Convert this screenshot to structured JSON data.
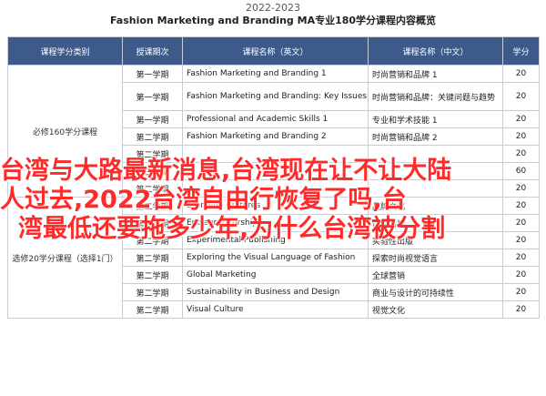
{
  "header": {
    "year": "2022-2023",
    "title": "Fashion Marketing and Branding MA专业180学分课程内容概览"
  },
  "table": {
    "columns": [
      "课程学分类别",
      "授课期次",
      "课程名称（英文）",
      "课程名称（中文）",
      "学分"
    ],
    "categories": [
      "必修160学分课程",
      "选修20学分课程（选择1门）"
    ],
    "rows": [
      {
        "term": "第一学期",
        "en": "Fashion Marketing and Branding 1",
        "cn": "时尚营销和品牌 1",
        "credits": "20"
      },
      {
        "term": "第一学期",
        "en": "Fashion Marketing and Branding: Key Issues and Trends",
        "cn": "时尚营销和品牌：关键问题与趋势",
        "credits": "20"
      },
      {
        "term": "第一学期",
        "en": "Professional and Academic Skills 1",
        "cn": "专业和学术技能 1",
        "credits": "20"
      },
      {
        "term": "第二学期",
        "en": "Fashion Marketing and Branding 2",
        "cn": "时尚营销和品牌 2",
        "credits": "20"
      },
      {
        "term": "第二学期",
        "en": "",
        "cn": "",
        "credits": "20"
      },
      {
        "term": "第三学期",
        "en": "",
        "cn": "",
        "credits": "60"
      },
      {
        "term": "第二学期",
        "en": "",
        "cn": "",
        "credits": "20"
      },
      {
        "term": "第二学期",
        "en": "Branding Cultures",
        "cn": "品牌文化",
        "credits": "20"
      },
      {
        "term": "第二学期",
        "en": "Entrepreneurship",
        "cn": "创业精神",
        "credits": "20"
      },
      {
        "term": "第二学期",
        "en": "Experimental Publishing",
        "cn": "实验性出版",
        "credits": "20"
      },
      {
        "term": "第二学期",
        "en": "Exploring the Visual Language of Fashion",
        "cn": "探索时尚视觉语言",
        "credits": "20"
      },
      {
        "term": "第二学期",
        "en": "Global Marketing",
        "cn": "全球营销",
        "credits": "20"
      },
      {
        "term": "第二学期",
        "en": "Sustainability in Business and Design",
        "cn": "商业与设计的可持续性",
        "credits": "20"
      },
      {
        "term": "第二学期",
        "en": "Visual Culture",
        "cn": "视觉文化",
        "credits": "20"
      }
    ]
  },
  "overlay": {
    "line1": "台湾与大路最新消息,台湾现在让不让大陆",
    "line2": "人过去,2022台湾自由行恢复了吗,台",
    "line3": "湾最低还要拖多少年,为什么台湾被分割"
  }
}
